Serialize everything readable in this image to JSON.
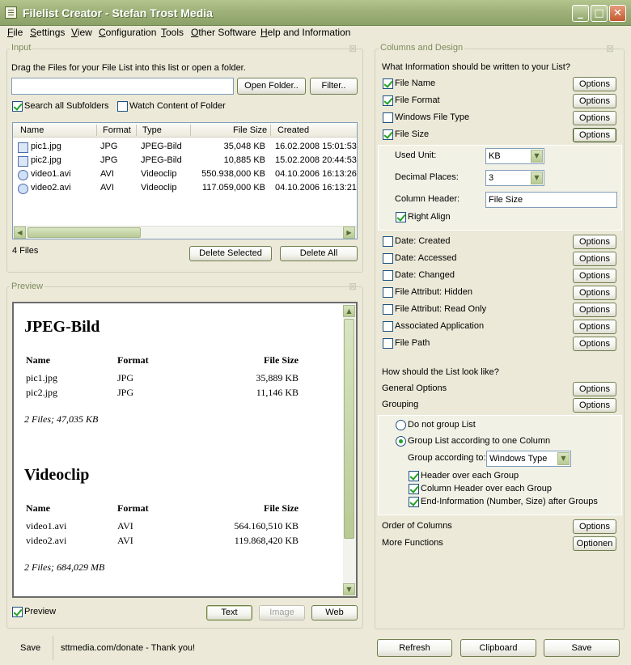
{
  "window": {
    "title": "Filelist Creator - Stefan Trost Media"
  },
  "menu": [
    "File",
    "Settings",
    "View",
    "Configuration",
    "Tools",
    "Other Software",
    "Help and Information"
  ],
  "input": {
    "group_title": "Input",
    "instruction": "Drag the Files for your File List into this list or open a folder.",
    "path_value": "",
    "open_folder_label": "Open Folder..",
    "filter_label": "Filter..",
    "search_subfolders": {
      "label": "Search all Subfolders",
      "checked": true
    },
    "watch_folder": {
      "label": "Watch Content of Folder",
      "checked": false
    },
    "columns": [
      "Name",
      "Format",
      "Type",
      "File Size",
      "Created"
    ],
    "rows": [
      {
        "name": "pic1.jpg",
        "format": "JPG",
        "type": "JPEG-Bild",
        "size": "35,048 KB",
        "created": "16.02.2008 15:01:53",
        "icon": "image-file-icon"
      },
      {
        "name": "pic2.jpg",
        "format": "JPG",
        "type": "JPEG-Bild",
        "size": "10,885 KB",
        "created": "15.02.2008 20:44:53",
        "icon": "image-file-icon"
      },
      {
        "name": "video1.avi",
        "format": "AVI",
        "type": "Videoclip",
        "size": "550.938,000 KB",
        "created": "04.10.2006 16:13:26",
        "icon": "video-file-icon"
      },
      {
        "name": "video2.avi",
        "format": "AVI",
        "type": "Videoclip",
        "size": "117.059,000 KB",
        "created": "04.10.2006 16:13:21",
        "icon": "video-file-icon"
      }
    ],
    "file_count": "4 Files",
    "delete_selected_label": "Delete Selected",
    "delete_all_label": "Delete All"
  },
  "preview": {
    "group_title": "Preview",
    "groups": [
      {
        "heading": "JPEG-Bild",
        "headers": [
          "Name",
          "Format",
          "File Size"
        ],
        "rows": [
          [
            "pic1.jpg",
            "JPG",
            "35,889 KB"
          ],
          [
            "pic2.jpg",
            "JPG",
            "11,146 KB"
          ]
        ],
        "summary": "2 Files; 47,035 KB"
      },
      {
        "heading": "Videoclip",
        "headers": [
          "Name",
          "Format",
          "File Size"
        ],
        "rows": [
          [
            "video1.avi",
            "AVI",
            "564.160,510 KB"
          ],
          [
            "video2.avi",
            "AVI",
            "119.868,420 KB"
          ]
        ],
        "summary": "2 Files; 684,029 MB"
      }
    ],
    "preview_checkbox": {
      "label": "Preview",
      "checked": true
    },
    "text_label": "Text",
    "image_label": "Image",
    "web_label": "Web"
  },
  "columns": {
    "group_title": "Columns and Design",
    "question": "What Information should be written to your List?",
    "options_label": "Options",
    "top_items": [
      {
        "label": "File Name",
        "checked": true
      },
      {
        "label": "File Format",
        "checked": true
      },
      {
        "label": "Windows File Type",
        "checked": false
      },
      {
        "label": "File Size",
        "checked": true
      }
    ],
    "size_panel": {
      "unit_label": "Used Unit:",
      "unit_value": "KB",
      "decimal_label": "Decimal Places:",
      "decimal_value": "3",
      "header_label": "Column Header:",
      "header_value": "File Size",
      "right_align": {
        "label": "Right Align",
        "checked": true
      }
    },
    "bottom_items": [
      {
        "label": "Date: Created",
        "checked": false
      },
      {
        "label": "Date: Accessed",
        "checked": false
      },
      {
        "label": "Date: Changed",
        "checked": false
      },
      {
        "label": "File Attribut: Hidden",
        "checked": false
      },
      {
        "label": "File Attribut: Read Only",
        "checked": false
      },
      {
        "label": "Associated Application",
        "checked": false
      },
      {
        "label": "File Path",
        "checked": false
      }
    ],
    "look_question": "How should the List look like?",
    "general_options": "General Options",
    "grouping": "Grouping",
    "grouping_panel": {
      "no_group": "Do not group List",
      "one_column": "Group List according to one Column",
      "according_label": "Group according to:",
      "according_value": "Windows Type",
      "header_each": "Header over each Group",
      "col_header_each": "Column Header over each Group",
      "end_info": "End-Information (Number, Size) after Groups"
    },
    "order_columns": "Order of Columns",
    "more_functions": "More Functions",
    "optionen_label": "Optionen"
  },
  "statusbar": {
    "save_label": "Save",
    "donate": "sttmedia.com/donate - Thank you!"
  },
  "bottom_buttons": {
    "refresh": "Refresh",
    "clipboard": "Clipboard",
    "save": "Save"
  }
}
